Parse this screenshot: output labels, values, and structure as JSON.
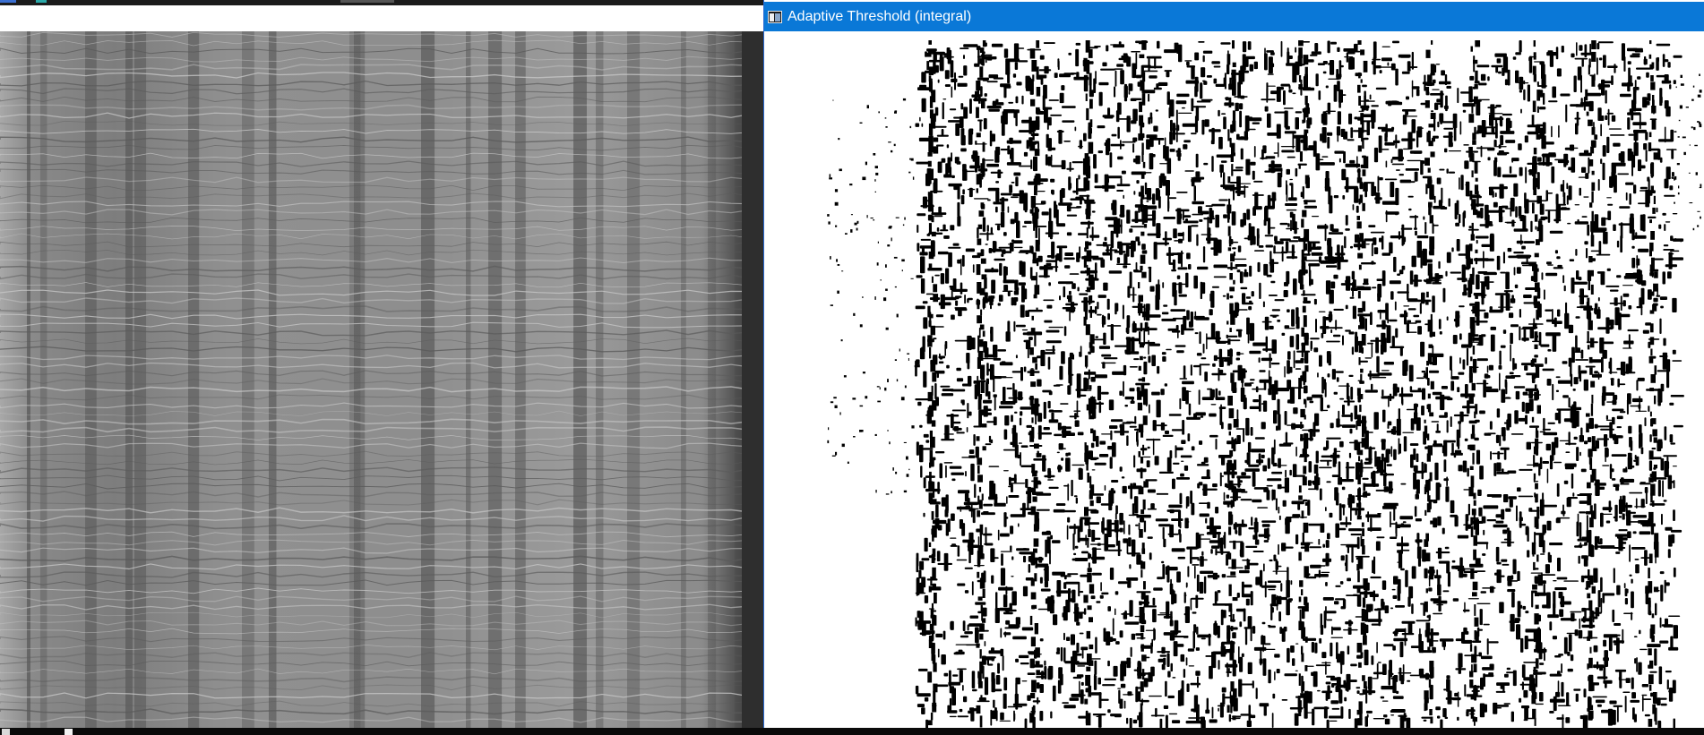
{
  "windows": {
    "source": {
      "content": "grayscale-texture-image"
    },
    "threshold": {
      "title": "Adaptive Threshold (integral)",
      "icon": "app-window-icon",
      "content": "binary-threshold-image"
    }
  },
  "colors": {
    "titlebar": "#0a78d7",
    "title_text": "#ffffff",
    "threshold_ink": "#000000",
    "threshold_paper": "#ffffff",
    "source_dark_band": "#2d2d2d",
    "taskbar": "#0a0a0a"
  },
  "taskbar": {
    "icons": [
      "windows-start-icon",
      "app-icon"
    ]
  }
}
